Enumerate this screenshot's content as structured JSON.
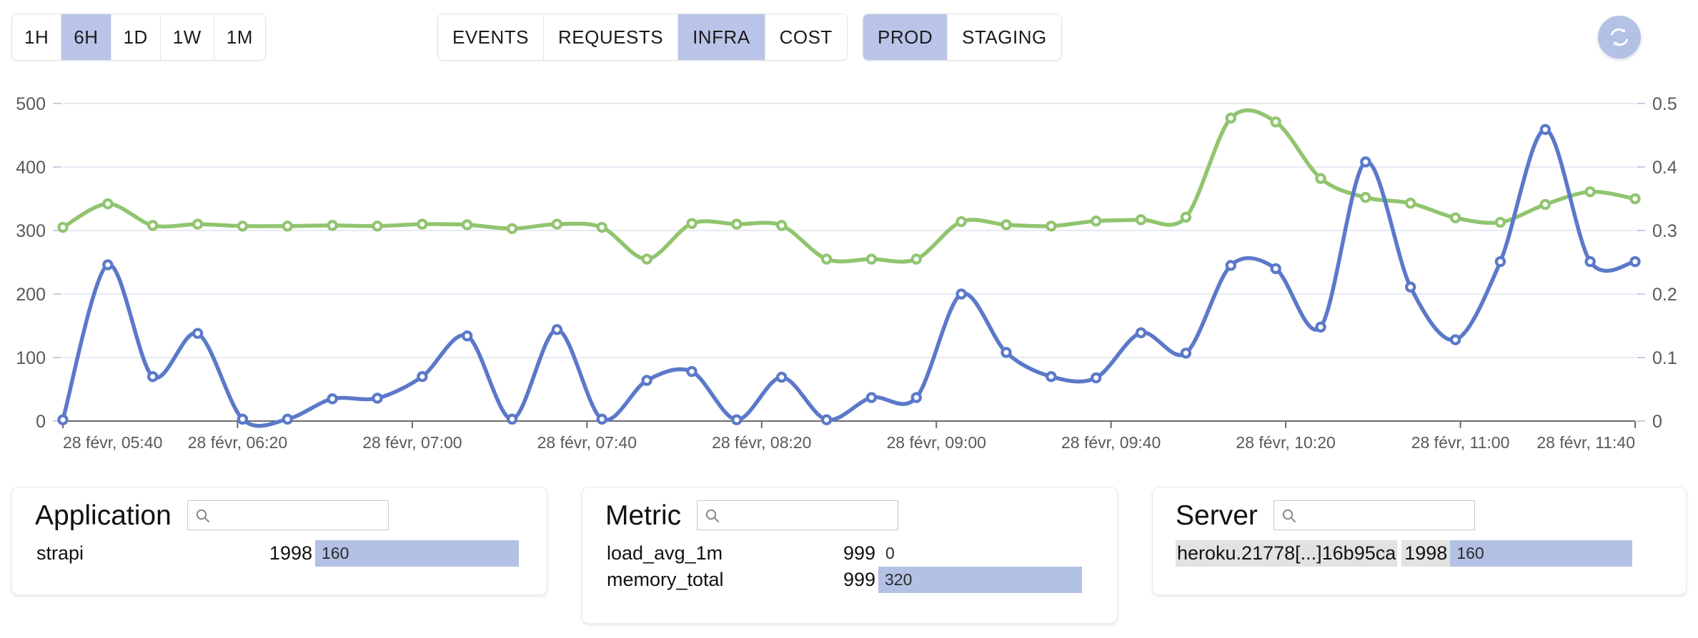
{
  "toolbar": {
    "range_group": {
      "name": "time-range",
      "options": [
        "1H",
        "6H",
        "1D",
        "1W",
        "1M"
      ],
      "selected": "6H"
    },
    "view_group": {
      "name": "view",
      "options": [
        "EVENTS",
        "REQUESTS",
        "INFRA",
        "COST"
      ],
      "selected": "INFRA"
    },
    "env_group": {
      "name": "environment",
      "options": [
        "PROD",
        "STAGING"
      ],
      "selected": "PROD"
    },
    "refresh_icon": "refresh-icon",
    "accent_color": "#b3c1e5"
  },
  "chart_data": {
    "type": "line",
    "title": "",
    "xlabel": "",
    "ylabel": "",
    "grid": true,
    "legend_position": "none",
    "x_tick_labels": [
      "28 févr, 05:40",
      "28 févr, 06:20",
      "28 févr, 07:00",
      "28 févr, 07:40",
      "28 févr, 08:20",
      "28 févr, 09:00",
      "28 févr, 09:40",
      "28 févr, 10:20",
      "28 févr, 11:00",
      "28 févr, 11:40"
    ],
    "y_left_ticks": [
      0,
      100,
      200,
      300,
      400,
      500
    ],
    "y_left_lim": [
      0,
      500
    ],
    "y_right_ticks": [
      "0",
      "0.1",
      "0.2",
      "0.3",
      "0.4",
      "0.5"
    ],
    "y_right_lim": [
      0,
      0.5
    ],
    "series": [
      {
        "name": "memory_total",
        "color": "#91c46f",
        "axis": "left",
        "values": [
          305,
          342,
          308,
          310,
          307,
          307,
          308,
          307,
          310,
          309,
          303,
          310,
          305,
          255,
          311,
          310,
          308,
          255,
          255,
          255,
          314,
          309,
          307,
          315,
          317,
          321,
          477,
          471,
          382,
          352,
          343,
          320,
          313,
          341,
          361,
          350
        ]
      },
      {
        "name": "load_avg_1m",
        "color": "#5b79c9",
        "axis": "left",
        "values": [
          2,
          246,
          70,
          138,
          3,
          3,
          35,
          36,
          70,
          134,
          3,
          144,
          3,
          64,
          78,
          2,
          69,
          2,
          37,
          37,
          200,
          108,
          70,
          68,
          139,
          107,
          245,
          240,
          148,
          408,
          211,
          128,
          251,
          459,
          251,
          251
        ]
      }
    ]
  },
  "panels": [
    {
      "id": "application",
      "title": "Application",
      "search_placeholder": "",
      "search_value": "",
      "search_icon": "search-icon",
      "rows": [
        {
          "label": "strapi",
          "count": "1998",
          "value": "160",
          "bar_ratio": 1.0,
          "highlighted": false
        }
      ]
    },
    {
      "id": "metric",
      "title": "Metric",
      "search_placeholder": "",
      "search_value": "",
      "search_icon": "search-icon",
      "rows": [
        {
          "label": "load_avg_1m",
          "count": "999",
          "value": "0",
          "bar_ratio": 0.0,
          "highlighted": false
        },
        {
          "label": "memory_total",
          "count": "999",
          "value": "320",
          "bar_ratio": 1.0,
          "highlighted": false
        }
      ]
    },
    {
      "id": "server",
      "title": "Server",
      "search_placeholder": "",
      "search_value": "",
      "search_icon": "search-icon",
      "rows": [
        {
          "label": "heroku.21778[...]16b95ca",
          "count": "1998",
          "value": "160",
          "bar_ratio": 1.0,
          "highlighted": true
        }
      ]
    }
  ]
}
